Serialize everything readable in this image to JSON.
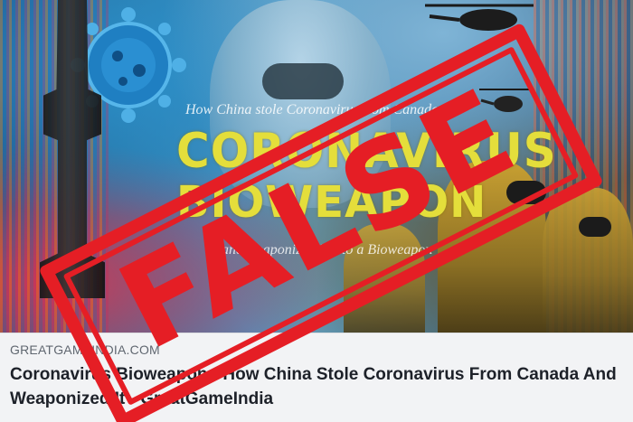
{
  "cover": {
    "poster_subtitle": "How China stole Coronavirus from Canada",
    "poster_title_line1": "CORONAVIRUS",
    "poster_title_line2": "BIOWEAPON",
    "poster_tagline": "and weaponized it into a Bioweapon"
  },
  "stamp": {
    "text": "FALSE",
    "color": "#e51e25"
  },
  "caption": {
    "domain": "GREATGAMEINDIA.COM",
    "headline": "Coronavirus Bioweapon - How China Stole Coronavirus From Canada And Weaponized It - GreatGameIndia"
  },
  "colors": {
    "caption_bg": "#f2f3f5",
    "domain_text": "#606770",
    "headline_text": "#1d2129",
    "poster_title": "#e4de3b"
  }
}
